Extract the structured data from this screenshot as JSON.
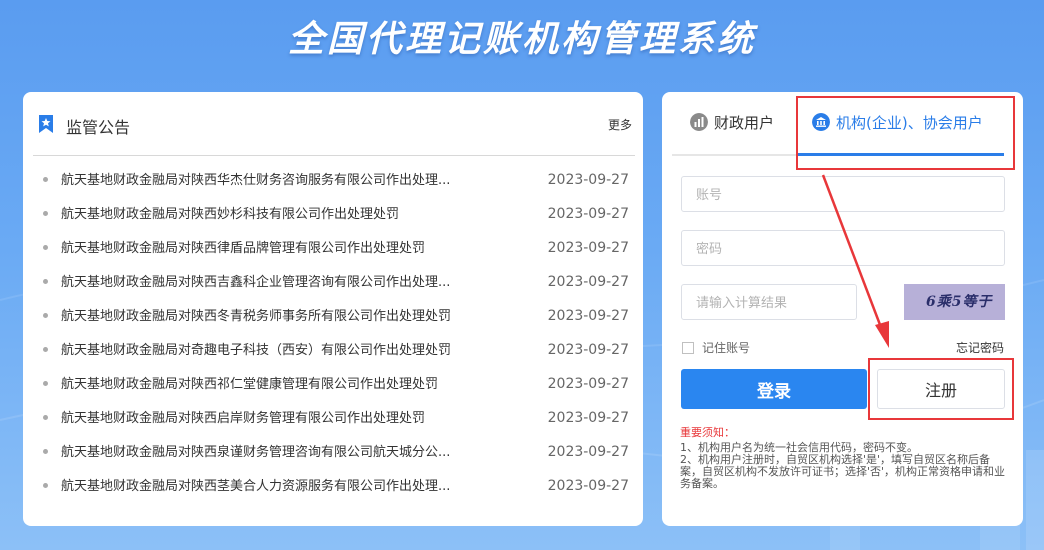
{
  "header": {
    "title": "全国代理记账机构管理系统"
  },
  "notice": {
    "title": "监管公告",
    "more": "更多",
    "items": [
      {
        "text": "航天基地财政金融局对陕西华杰仕财务咨询服务有限公司作出处理...",
        "date": "2023-09-27"
      },
      {
        "text": "航天基地财政金融局对陕西妙杉科技有限公司作出处理处罚",
        "date": "2023-09-27"
      },
      {
        "text": "航天基地财政金融局对陕西律盾品牌管理有限公司作出处理处罚",
        "date": "2023-09-27"
      },
      {
        "text": "航天基地财政金融局对陕西吉鑫科企业管理咨询有限公司作出处理...",
        "date": "2023-09-27"
      },
      {
        "text": "航天基地财政金融局对陕西冬青税务师事务所有限公司作出处理处罚",
        "date": "2023-09-27"
      },
      {
        "text": "航天基地财政金融局对奇趣电子科技（西安）有限公司作出处理处罚",
        "date": "2023-09-27"
      },
      {
        "text": "航天基地财政金融局对陕西祁仁堂健康管理有限公司作出处理处罚",
        "date": "2023-09-27"
      },
      {
        "text": "航天基地财政金融局对陕西启岸财务管理有限公司作出处理处罚",
        "date": "2023-09-27"
      },
      {
        "text": "航天基地财政金融局对陕西泉谨财务管理咨询有限公司航天城分公...",
        "date": "2023-09-27"
      },
      {
        "text": "航天基地财政金融局对陕西茎美合人力资源服务有限公司作出处理...",
        "date": "2023-09-27"
      }
    ]
  },
  "login": {
    "tab_finance": "财政用户",
    "tab_org": "机构(企业)、协会用户",
    "account_placeholder": "账号",
    "password_placeholder": "密码",
    "captcha_placeholder": "请输入计算结果",
    "captcha_text": "6乘5等于",
    "remember_label": "记住账号",
    "forgot_label": "忘记密码",
    "login_button": "登录",
    "register_button": "注册",
    "notes_head": "重要须知：",
    "notes_line1": "1、机构用户名为统一社会信用代码，密码不变。",
    "notes_line2": "2、机构用户注册时，自贸区机构选择'是'，填写自贸区名称后备案，自贸区机构不发放许可证书；选择'否'，机构正常资格申请和业务备案。"
  },
  "colors": {
    "accent": "#2a86f0",
    "highlight": "#e8373a",
    "background": "#6aaaf4"
  }
}
